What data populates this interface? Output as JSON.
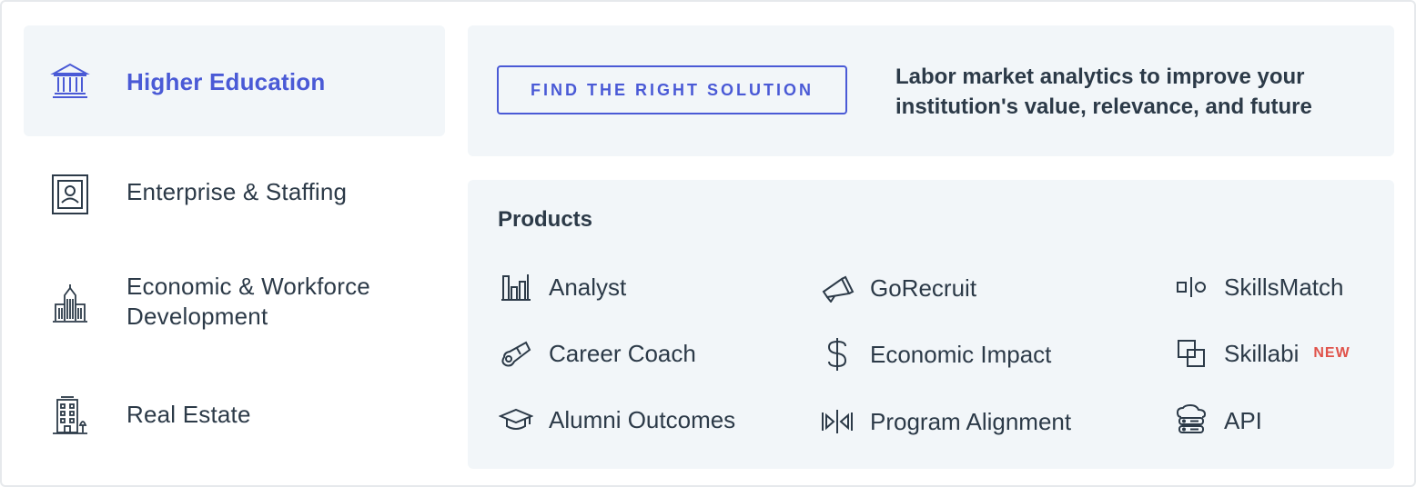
{
  "sidebar": {
    "items": [
      {
        "label": "Higher Education",
        "icon": "building-columns-icon",
        "active": true
      },
      {
        "label": "Enterprise & Staffing",
        "icon": "id-portrait-icon",
        "active": false
      },
      {
        "label": "Economic & Workforce\nDevelopment",
        "icon": "city-skyline-icon",
        "active": false
      },
      {
        "label": "Real Estate",
        "icon": "apartment-building-icon",
        "active": false
      }
    ]
  },
  "hero": {
    "cta_label": "FIND THE RIGHT SOLUTION",
    "text": "Labor market analytics to improve your institution's value, relevance, and future"
  },
  "products": {
    "title": "Products",
    "items": [
      {
        "label": "Analyst",
        "icon": "bar-chart-icon"
      },
      {
        "label": "Career Coach",
        "icon": "whistle-icon"
      },
      {
        "label": "Alumni Outcomes",
        "icon": "graduation-cap-icon"
      },
      {
        "label": "GoRecruit",
        "icon": "megaphone-icon"
      },
      {
        "label": "Economic Impact",
        "icon": "dollar-icon"
      },
      {
        "label": "Program Alignment",
        "icon": "align-arrows-icon"
      },
      {
        "label": "SkillsMatch",
        "icon": "match-icon"
      },
      {
        "label": "Skillabi",
        "icon": "overlap-squares-icon",
        "badge": "NEW"
      },
      {
        "label": "API",
        "icon": "cloud-server-icon"
      }
    ]
  },
  "colors": {
    "accent": "#4a5ad6",
    "text": "#2c3a48",
    "panel": "#f2f6f9",
    "badge": "#e0524a"
  }
}
